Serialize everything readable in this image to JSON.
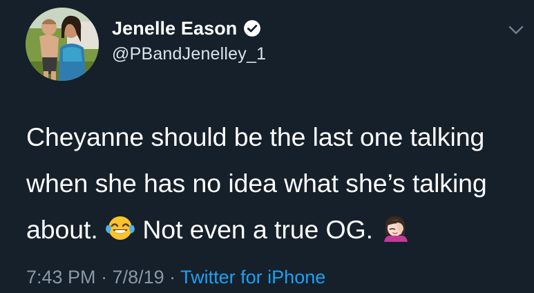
{
  "tweet": {
    "display_name": "Jenelle Eason",
    "handle": "@PBandJenelley_1",
    "text_lines": [
      "Cheyanne should be the last one talking",
      "when she has no idea what she’s talking",
      "about."
    ],
    "text_line3_after_emoji": " Not even a true OG.",
    "emoji_1": "face-with-tears-of-joy",
    "emoji_2": "woman-facepalming",
    "time": "7:43 PM",
    "separator": " · ",
    "date": "7/8/19",
    "source": "Twitter for iPhone"
  },
  "icons": {
    "verified": "verified-badge-icon",
    "more": "chevron-down-icon"
  },
  "colors": {
    "background": "#15202b",
    "text": "#ffffff",
    "meta": "#8899a6",
    "link": "#1da1f2"
  }
}
